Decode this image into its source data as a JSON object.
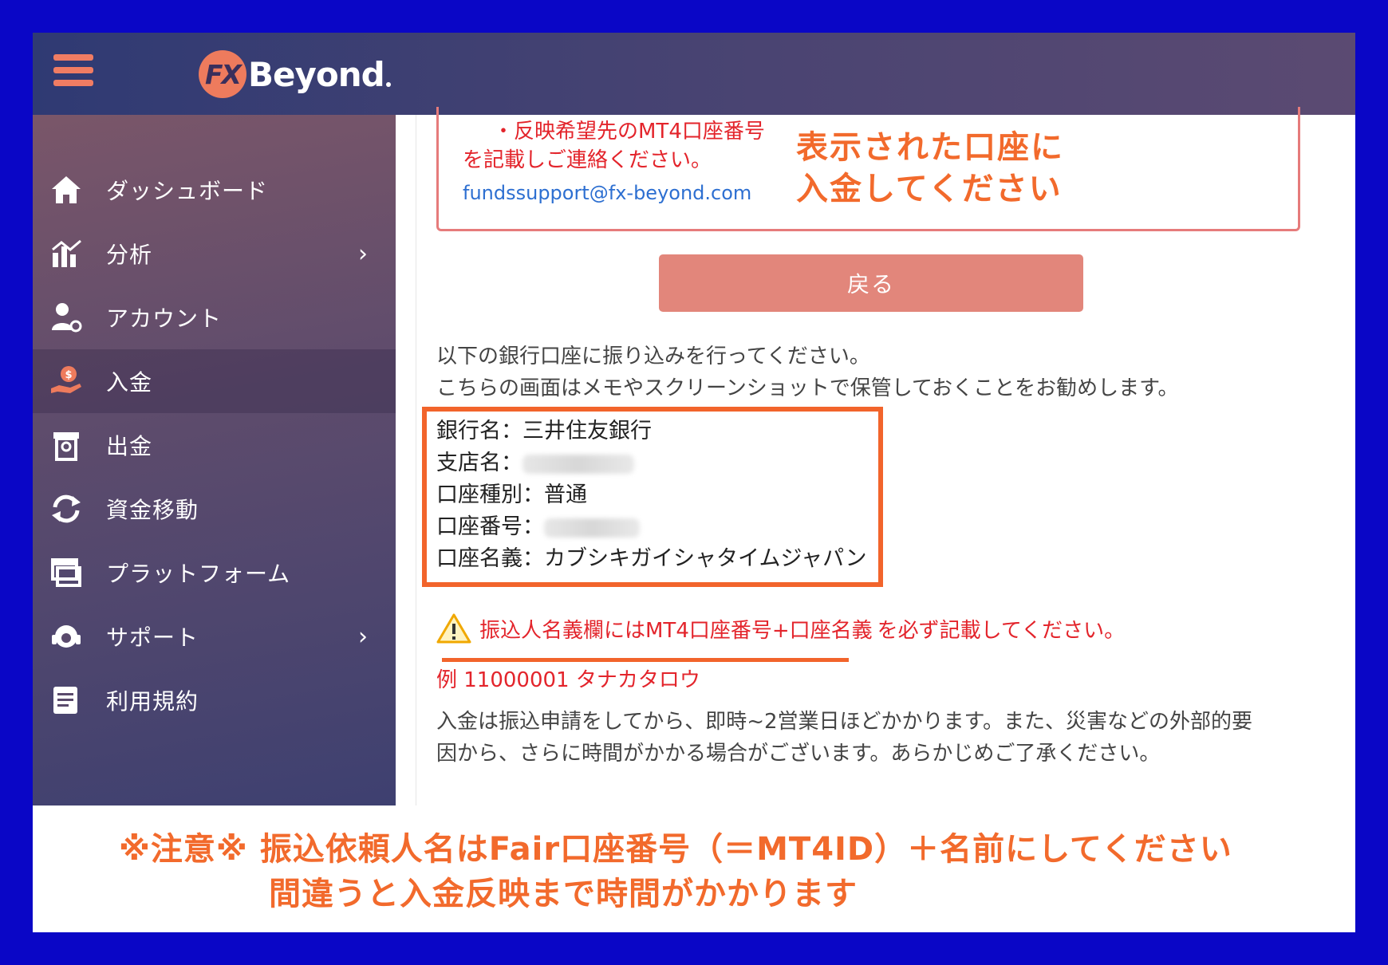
{
  "header": {
    "logo_fx": "FX",
    "logo_text": "Beyond"
  },
  "sidebar": {
    "items": [
      {
        "label": "ダッシュボード",
        "icon": "home-icon"
      },
      {
        "label": "分析",
        "icon": "chart-icon",
        "chevron": "›"
      },
      {
        "label": "アカウント",
        "icon": "user-gear-icon"
      },
      {
        "label": "入金",
        "icon": "deposit-icon"
      },
      {
        "label": "出金",
        "icon": "withdraw-icon"
      },
      {
        "label": "資金移動",
        "icon": "transfer-icon"
      },
      {
        "label": "プラットフォーム",
        "icon": "platform-icon"
      },
      {
        "label": "サポート",
        "icon": "headset-icon",
        "chevron": "›"
      },
      {
        "label": "利用規約",
        "icon": "document-icon"
      }
    ],
    "active_index": 3
  },
  "infobox": {
    "line1": "・反映希望先のMT4口座番号",
    "line2": "を記載しご連絡ください。",
    "email": "fundssupport@fx-beyond.com"
  },
  "callout": {
    "line1": "表示された口座に",
    "line2": "入金してください"
  },
  "back_button": "戻る",
  "instructions": {
    "line1": "以下の銀行口座に振り込みを行ってください。",
    "line2": "こちらの画面はメモやスクリーンショットで保管しておくことをお勧めします。"
  },
  "bank": {
    "bank_name_label": "銀行名：",
    "bank_name": "三井住友銀行",
    "branch_label": "支店名：",
    "account_type_label": "口座種別：",
    "account_type": "普通",
    "account_number_label": "口座番号：",
    "account_holder_label": "口座名義：",
    "account_holder": "カブシキガイシャタイムジャパン"
  },
  "warning": {
    "highlight": "振込人名義欄にはMT4口座番号+口座名義",
    "rest": "を必ず記載してください。",
    "example": "例 11000001 タナカタロウ"
  },
  "notice": {
    "line1": "入金は振込申請をしてから、即時~2営業日ほどかかります。また、災害などの外部的要",
    "line2": "因から、さらに時間がかかる場合がございます。あらかじめご了承ください。"
  },
  "caution": {
    "line1": "※注意※ 振込依頼人名はFair口座番号（＝MT4ID）＋名前にしてください",
    "line2": "間違うと入金反映まで時間がかかります"
  },
  "colors": {
    "outer_border": "#0a06c6",
    "accent_orange": "#f26a2c",
    "warning_red": "#e3242b",
    "back_button": "#e2867b"
  }
}
